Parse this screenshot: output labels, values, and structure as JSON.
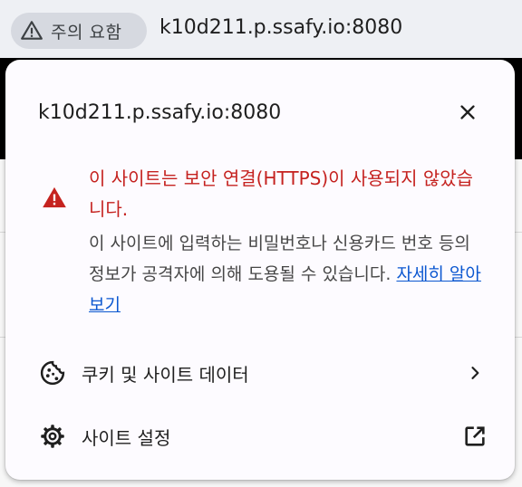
{
  "omnibox": {
    "chip_label": "주의 요함",
    "url": "k10d211.p.ssafy.io:8080"
  },
  "popup": {
    "title": "k10d211.p.ssafy.io:8080",
    "warning_title": "이 사이트는 보안 연결(HTTPS)이 사용되지 않았습니다.",
    "warning_desc": "이 사이트에 입력하는 비밀번호나 신용카드 번호 등의 정보가 공격자에 의해 도용될 수 있습니다.",
    "learn_more": "자세히 알아보기",
    "rows": [
      {
        "label": "쿠키 및 사이트 데이터",
        "icon": "cookie-icon",
        "end_icon": "chevron-right-icon"
      },
      {
        "label": "사이트 설정",
        "icon": "gear-icon",
        "end_icon": "open-in-new-icon"
      }
    ]
  },
  "colors": {
    "warning": "#c5221f",
    "link": "#0b57d0",
    "chip_bg": "#d6d9e0"
  }
}
